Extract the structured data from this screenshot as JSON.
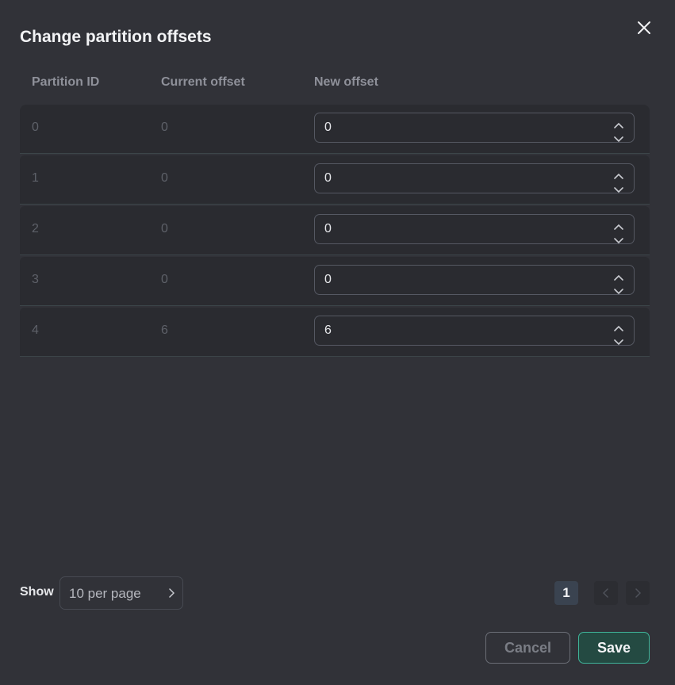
{
  "dialog": {
    "title": "Change partition offsets",
    "close_icon": "close-icon"
  },
  "table": {
    "headers": [
      "Partition ID",
      "Current offset",
      "New offset"
    ],
    "rows": [
      {
        "partition_id": "0",
        "current_offset": "0",
        "new_offset": "0"
      },
      {
        "partition_id": "1",
        "current_offset": "0",
        "new_offset": "0"
      },
      {
        "partition_id": "2",
        "current_offset": "0",
        "new_offset": "0"
      },
      {
        "partition_id": "3",
        "current_offset": "0",
        "new_offset": "0"
      },
      {
        "partition_id": "4",
        "current_offset": "6",
        "new_offset": "6"
      }
    ]
  },
  "pagination": {
    "show_label": "Show",
    "per_page": "10 per page",
    "current_page": "1"
  },
  "actions": {
    "cancel_label": "Cancel",
    "save_label": "Save"
  },
  "colors": {
    "background": "#313238",
    "accent": "#3fb59a",
    "save_bg": "#244a42"
  }
}
